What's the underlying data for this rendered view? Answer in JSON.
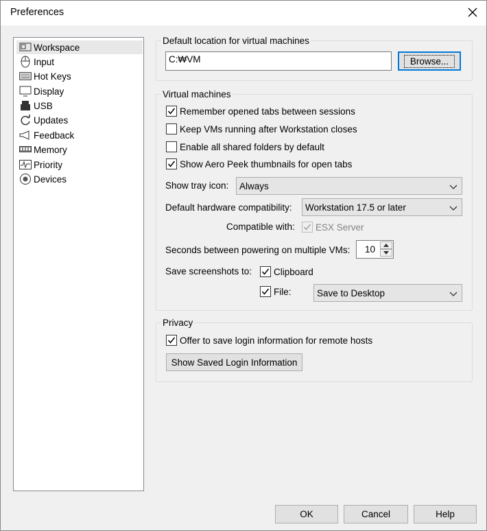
{
  "window": {
    "title": "Preferences"
  },
  "sidebar": {
    "items": [
      {
        "label": "Workspace",
        "icon": "workspace-icon"
      },
      {
        "label": "Input",
        "icon": "mouse-icon"
      },
      {
        "label": "Hot Keys",
        "icon": "keyboard-icon"
      },
      {
        "label": "Display",
        "icon": "monitor-icon"
      },
      {
        "label": "USB",
        "icon": "usb-icon"
      },
      {
        "label": "Updates",
        "icon": "refresh-icon"
      },
      {
        "label": "Feedback",
        "icon": "megaphone-icon"
      },
      {
        "label": "Memory",
        "icon": "memory-icon"
      },
      {
        "label": "Priority",
        "icon": "pulse-icon"
      },
      {
        "label": "Devices",
        "icon": "devices-icon"
      }
    ],
    "selected": "Workspace"
  },
  "default_location": {
    "title": "Default location for virtual machines",
    "path": "C:₩VM",
    "browse_label": "Browse..."
  },
  "virtual_machines": {
    "title": "Virtual machines",
    "checks": [
      {
        "label": "Remember opened tabs between sessions",
        "checked": true
      },
      {
        "label": "Keep VMs running after Workstation closes",
        "checked": false
      },
      {
        "label": "Enable all shared folders by default",
        "checked": false
      },
      {
        "label": "Show Aero Peek thumbnails for open tabs",
        "checked": true
      }
    ],
    "tray_label": "Show tray icon:",
    "tray_value": "Always",
    "hw_label": "Default hardware compatibility:",
    "hw_value": "Workstation 17.5 or later",
    "compat_label": "Compatible with:",
    "compat_value": "ESX Server",
    "seconds_label": "Seconds between powering on multiple VMs:",
    "seconds_value": "10",
    "screens_label": "Save screenshots to:",
    "clipboard_label": "Clipboard",
    "file_label": "File:",
    "file_value": "Save to Desktop"
  },
  "privacy": {
    "title": "Privacy",
    "offer_label": "Offer to save login information for remote hosts",
    "show_button": "Show Saved Login Information"
  },
  "footer": {
    "ok": "OK",
    "cancel": "Cancel",
    "help": "Help"
  }
}
